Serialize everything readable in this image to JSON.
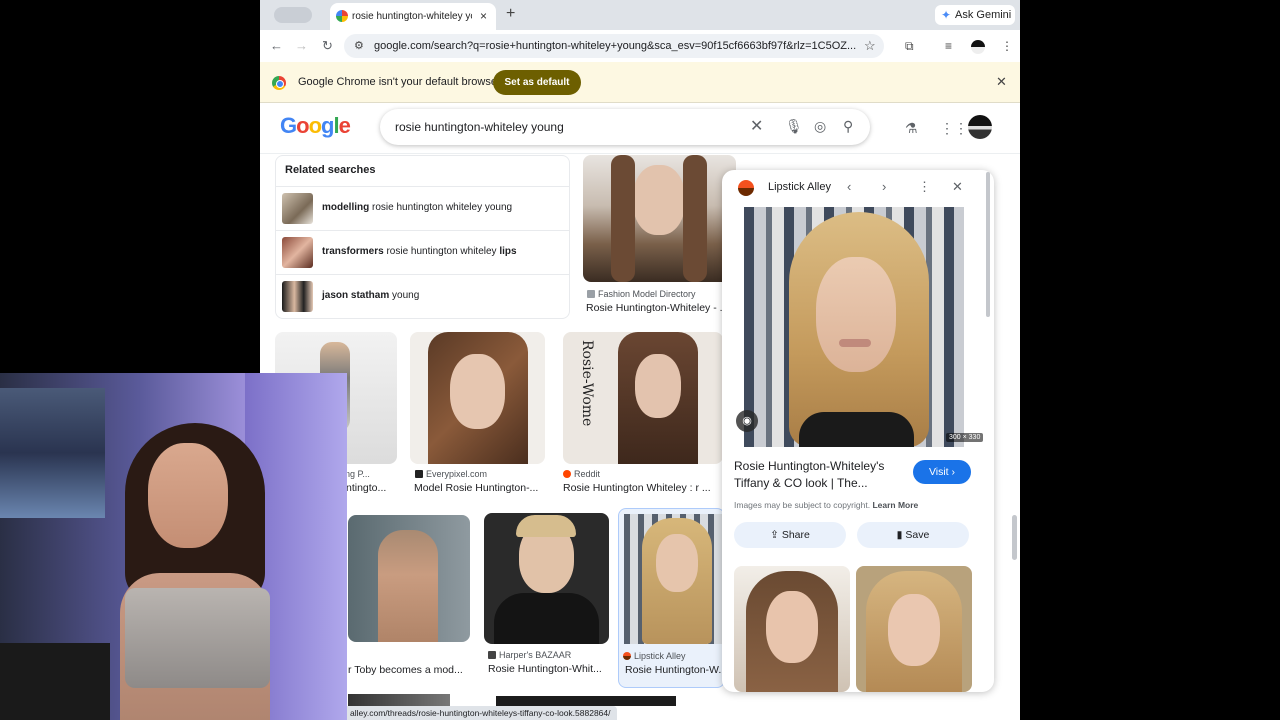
{
  "browser": {
    "tab_title": "rosie huntington-whiteley you",
    "tab_close": "×",
    "new_tab": "+",
    "ask_gemini": "Ask Gemini",
    "url": "google.com/search?q=rosie+huntington-whiteley+young&sca_esv=90f15cf6663bf97f&rlz=1C5OZ...",
    "back": "←",
    "forward": "→",
    "reload": "↻"
  },
  "infobar": {
    "message": "Google Chrome isn't your default browser",
    "button": "Set as default",
    "close": "✕"
  },
  "google": {
    "logo": "Google",
    "query": "rosie huntington-whiteley young"
  },
  "related": {
    "header": "Related searches",
    "items": [
      {
        "bold": "modelling",
        "rest": " rosie huntington whiteley young",
        "bold2": ""
      },
      {
        "bold": "transformers",
        "rest": " rosie huntington whiteley ",
        "bold2": "lips"
      },
      {
        "bold": "jason statham",
        "rest": " young",
        "bold2": ""
      }
    ]
  },
  "results": {
    "r1": {
      "source": "Fashion Model Directory",
      "title": "Rosie Huntington-Whiteley - ..."
    },
    "r2": {
      "source": "orning P...",
      "title": "ntingto..."
    },
    "r3": {
      "source": "Everypixel.com",
      "title": "Model Rosie Huntington-..."
    },
    "r4": {
      "source": "Reddit",
      "title": "Rosie Huntington Whiteley : r ..."
    },
    "r5": {
      "source": "",
      "title": "r Toby becomes a mod..."
    },
    "r6": {
      "source": "Harper's BAZAAR",
      "title": "Rosie Huntington-Whit..."
    },
    "r7": {
      "source": "Lipstick Alley",
      "title": "Rosie Huntington-W..."
    }
  },
  "image_text": {
    "r4_handwriting": "Rosie-Wome"
  },
  "panel": {
    "source": "Lipstick Alley",
    "title": "Rosie Huntington-Whiteley's Tiffany & CO look | The...",
    "visit": "Visit",
    "copyright": "Images may be subject to copyright.",
    "learn_more": "Learn More",
    "share": "Share",
    "save": "Save",
    "dims": "300 × 330"
  },
  "status_url": "alley.com/threads/rosie-huntington-whiteleys-tiffany-co-look.5882864/",
  "colors": {
    "accent": "#1a73e8",
    "set_default_bg": "#6d5f00",
    "infobar_bg": "#fdf8e2"
  }
}
